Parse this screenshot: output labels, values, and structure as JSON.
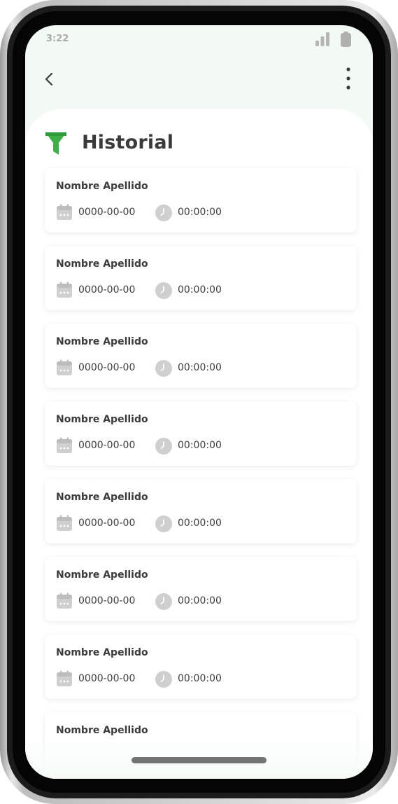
{
  "status_bar": {
    "time": "3:22"
  },
  "header": {
    "title": "Historial"
  },
  "history": [
    {
      "name": "Nombre Apellido",
      "date": "0000-00-00",
      "time": "00:00:00"
    },
    {
      "name": "Nombre Apellido",
      "date": "0000-00-00",
      "time": "00:00:00"
    },
    {
      "name": "Nombre Apellido",
      "date": "0000-00-00",
      "time": "00:00:00"
    },
    {
      "name": "Nombre Apellido",
      "date": "0000-00-00",
      "time": "00:00:00"
    },
    {
      "name": "Nombre Apellido",
      "date": "0000-00-00",
      "time": "00:00:00"
    },
    {
      "name": "Nombre Apellido",
      "date": "0000-00-00",
      "time": "00:00:00"
    },
    {
      "name": "Nombre Apellido",
      "date": "0000-00-00",
      "time": "00:00:00"
    },
    {
      "name": "Nombre Apellido",
      "date": "",
      "time": ""
    }
  ],
  "icons": {
    "back": "chevron-left-icon",
    "more": "more-vertical-icon",
    "filter": "filter-icon",
    "date": "calendar-icon",
    "time": "clock-icon",
    "signal": "signal-icon",
    "battery": "battery-icon"
  },
  "colors": {
    "accent": "#3fae49",
    "background": "#f3faf6",
    "card": "#ffffff",
    "text": "#3a3a3a",
    "icon_muted": "#cfcfcf"
  }
}
